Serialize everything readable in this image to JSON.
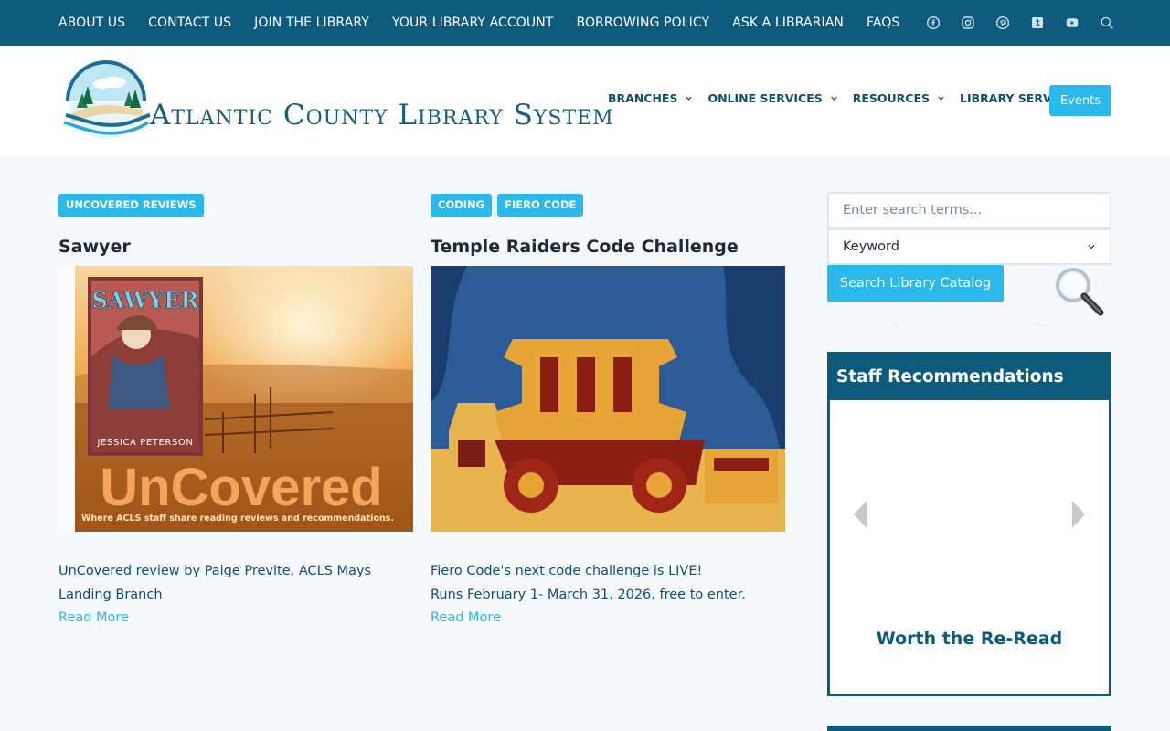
{
  "topbar": {
    "links": [
      "ABOUT US",
      "CONTACT US",
      "JOIN THE LIBRARY",
      "YOUR LIBRARY ACCOUNT",
      "BORROWING POLICY",
      "ASK A LIBRARIAN",
      "FAQS"
    ],
    "social_icons": [
      "facebook-icon",
      "instagram-icon",
      "pinterest-icon",
      "tumblr-icon",
      "youtube-icon"
    ],
    "search_icon": "search-icon"
  },
  "header": {
    "logo_text": "Atlantic County Library System",
    "nav": [
      "BRANCHES",
      "ONLINE SERVICES",
      "RESOURCES",
      "LIBRARY SERVICES"
    ],
    "events_label": "Events"
  },
  "posts": [
    {
      "tags": [
        "UNCOVERED REVIEWS"
      ],
      "title": "Sawyer",
      "image": {
        "book_title": "SAWYER",
        "author": "JESSICA PETERSON",
        "banner": "UnCovered",
        "tagline": "Where ACLS staff share reading reviews and recommendations."
      },
      "excerpt": "UnCovered review by Paige Previte, ACLS Mays Landing Branch",
      "read_more": "Read More"
    },
    {
      "tags": [
        "CODING",
        "FIERO CODE"
      ],
      "title": "Temple Raiders Code Challenge",
      "excerpt_line1": "Fiero Code's next code challenge is LIVE!",
      "excerpt_line2": "Runs February 1- March 31, 2026, free to enter.",
      "read_more": "Read More"
    }
  ],
  "sidebar": {
    "search_placeholder": "Enter search terms...",
    "search_type": "Keyword",
    "search_button": "Search Library Catalog",
    "staff_title": "Staff Recommendations",
    "slide_title": "Worth the Re-Read"
  },
  "colors": {
    "brand_dark": "#0e5a7c",
    "accent": "#2bb8ea",
    "page_bg": "#f6f9fb"
  }
}
